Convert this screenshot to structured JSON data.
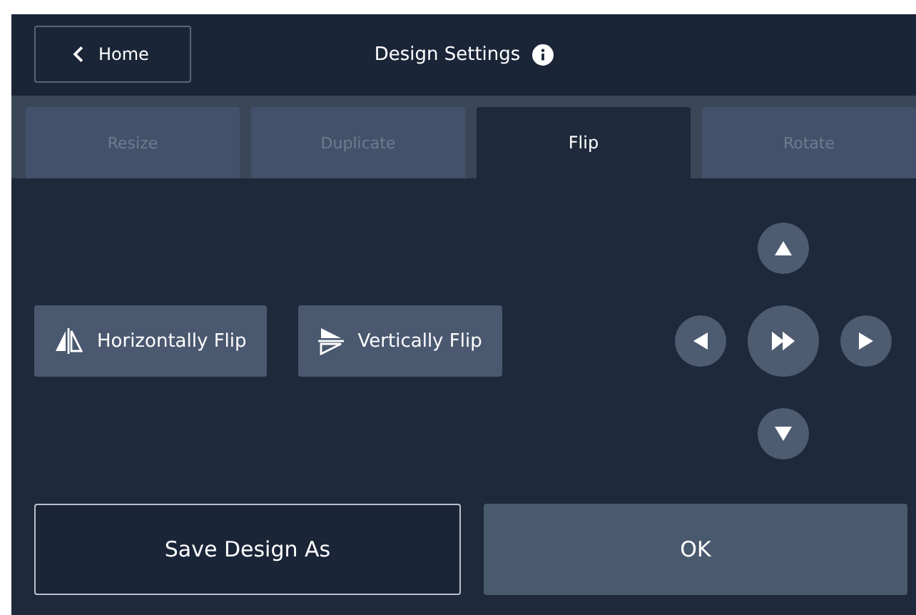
{
  "header": {
    "back_label": "Home",
    "title": "Design Settings"
  },
  "tabs": [
    {
      "label": "Resize",
      "selected": false,
      "disabled": true
    },
    {
      "label": "Duplicate",
      "selected": false,
      "disabled": true
    },
    {
      "label": "Flip",
      "selected": true,
      "disabled": false
    },
    {
      "label": "Rotate",
      "selected": false,
      "disabled": true
    }
  ],
  "flip_buttons": [
    {
      "kind": "horizontal",
      "label": "Horizontally Flip"
    },
    {
      "kind": "vertical",
      "label": "Vertically Flip"
    }
  ],
  "footer": {
    "save_label": "Save Design As",
    "ok_label": "OK"
  }
}
